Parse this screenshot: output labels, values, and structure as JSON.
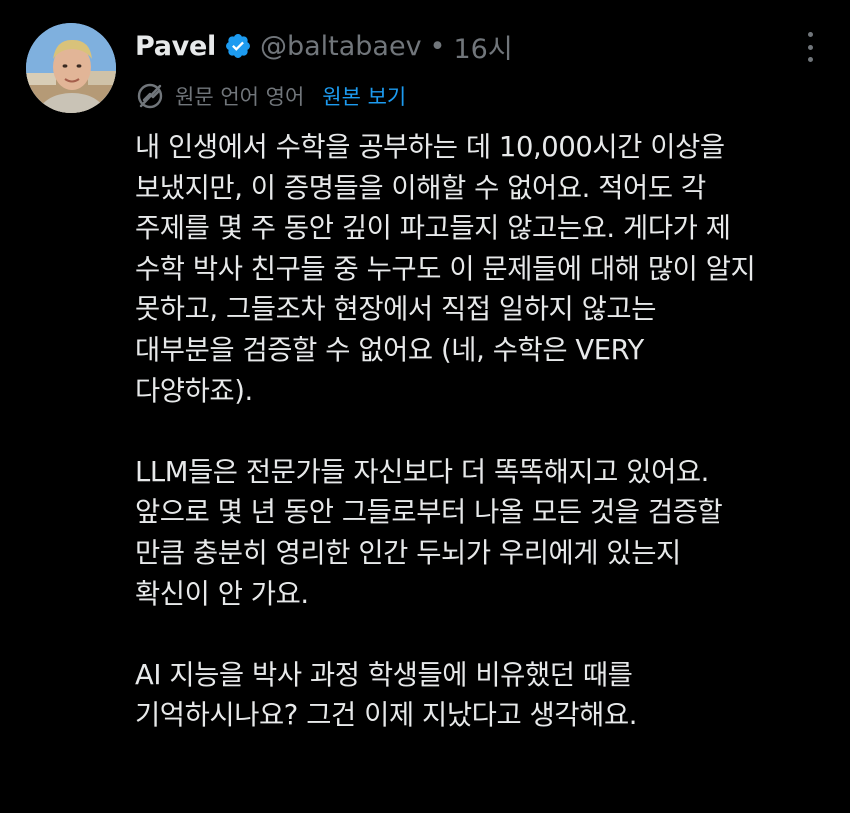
{
  "tweet": {
    "author_name": "Pavel",
    "handle": "@baltabaev",
    "separator": "•",
    "time": "16시",
    "avatar_icon": "avatar-photo",
    "verified_icon": "verified-badge-icon",
    "verified_color": "#1d9bf0",
    "more_icon": "more-options-icon",
    "translation": {
      "icon": "translate-icon",
      "note": "원문 언어 영어",
      "view_original": "원본 보기"
    },
    "paragraphs": [
      {
        "lines": [
          "내 인생에서 수학을 공부하는 데 10,000시간 이상을",
          "보냈지만, 이 증명들을 이해할 수 없어요. 적어도 각",
          "주제를 몇 주 동안 깊이 파고들지 않고는요. 게다가 제",
          "수학 박사 친구들 중 누구도 이 문제들에 대해 많이 알지",
          "못하고, 그들조차 현장에서 직접 일하지 않고는",
          "대부분을 검증할 수 없어요 (네, 수학은 VERY",
          "다양하죠)."
        ]
      },
      {
        "lines": [
          "LLM들은 전문가들 자신보다 더 똑똑해지고 있어요.",
          "앞으로 몇 년 동안 그들로부터 나올 모든 것을 검증할",
          "만큼 충분히 영리한 인간 두뇌가 우리에게 있는지",
          "확신이 안 가요."
        ]
      },
      {
        "lines": [
          "AI 지능을 박사 과정 학생들에 비유했던 때를",
          "기억하시나요? 그건 이제 지났다고 생각해요."
        ]
      }
    ]
  }
}
